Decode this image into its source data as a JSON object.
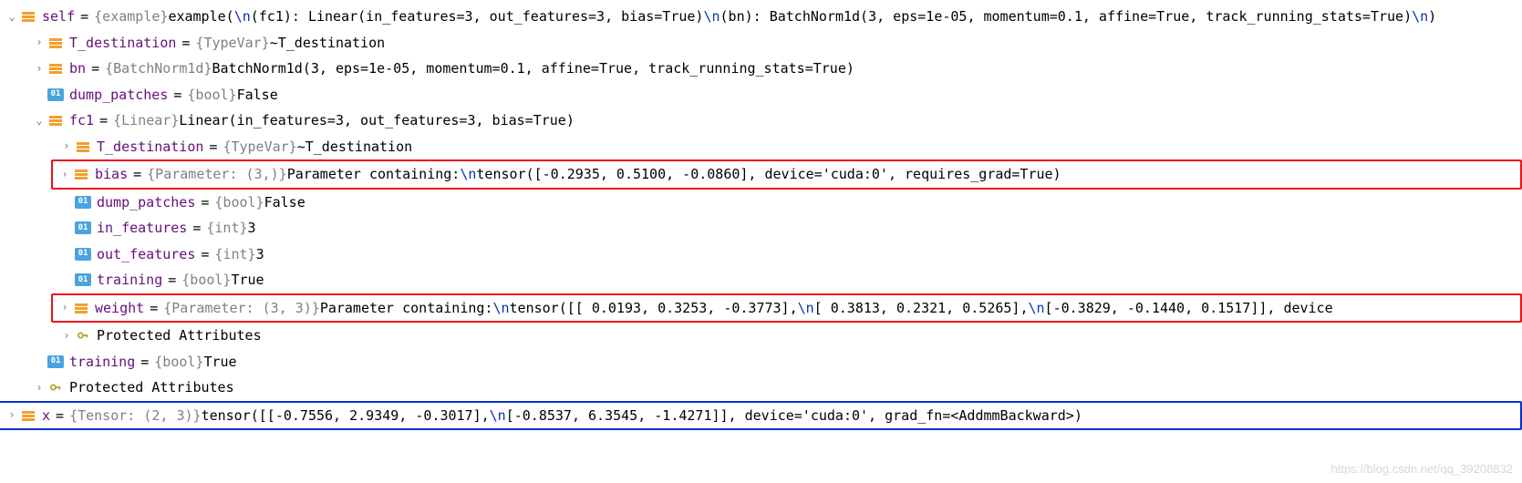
{
  "watermark": "https://blog.csdn.net/qq_39208832",
  "self": {
    "name": "self",
    "type": "{example}",
    "val_a": " example(",
    "esc1": "\\n",
    "val_b": "  (fc1): Linear(in_features=3, out_features=3, bias=True)",
    "esc2": "\\n",
    "val_c": "  (bn): BatchNorm1d(3, eps=1e-05, momentum=0.1, affine=True, track_running_stats=True)",
    "esc3": "\\n",
    "val_d": ")"
  },
  "tdest": {
    "name": "T_destination",
    "type": "{TypeVar}",
    "val": " ~T_destination"
  },
  "bn": {
    "name": "bn",
    "type": "{BatchNorm1d}",
    "val": " BatchNorm1d(3, eps=1e-05, momentum=0.1, affine=True, track_running_stats=True)"
  },
  "dump": {
    "name": "dump_patches",
    "type": "{bool}",
    "val": " False"
  },
  "fc1": {
    "name": "fc1",
    "type": "{Linear}",
    "val": " Linear(in_features=3, out_features=3, bias=True)"
  },
  "fc1_tdest": {
    "name": "T_destination",
    "type": "{TypeVar}",
    "val": " ~T_destination"
  },
  "bias": {
    "name": "bias",
    "type": "{Parameter: (3,)}",
    "val_a": " Parameter containing:",
    "esc1": "\\n",
    "val_b": "tensor([-0.2935,  0.5100, -0.0860], device='cuda:0', requires_grad=True)"
  },
  "fc1_dump": {
    "name": "dump_patches",
    "type": "{bool}",
    "val": " False"
  },
  "infeat": {
    "name": "in_features",
    "type": "{int}",
    "val": " 3"
  },
  "outfeat": {
    "name": "out_features",
    "type": "{int}",
    "val": " 3"
  },
  "fc1_train": {
    "name": "training",
    "type": "{bool}",
    "val": " True"
  },
  "weight": {
    "name": "weight",
    "type": "{Parameter: (3, 3)}",
    "val_a": " Parameter containing:",
    "esc1": "\\n",
    "val_b": "tensor([[ 0.0193,  0.3253, -0.3773],",
    "esc2": "\\n",
    "val_c": "        [ 0.3813,  0.2321,  0.5265],",
    "esc3": "\\n",
    "val_d": "        [-0.3829, -0.1440,  0.1517]], device"
  },
  "prot": "Protected Attributes",
  "train": {
    "name": "training",
    "type": "{bool}",
    "val": " True"
  },
  "x": {
    "name": "x",
    "type": "{Tensor: (2, 3)}",
    "val_a": " tensor([[-0.7556,  2.9349, -0.3017],",
    "esc1": "\\n",
    "val_b": "        [-0.8537,  6.3545, -1.4271]], device='cuda:0', grad_fn=<AddmmBackward>)"
  },
  "icons": {
    "expanded": "⌄",
    "collapsed": "›",
    "zero_one": "01"
  }
}
